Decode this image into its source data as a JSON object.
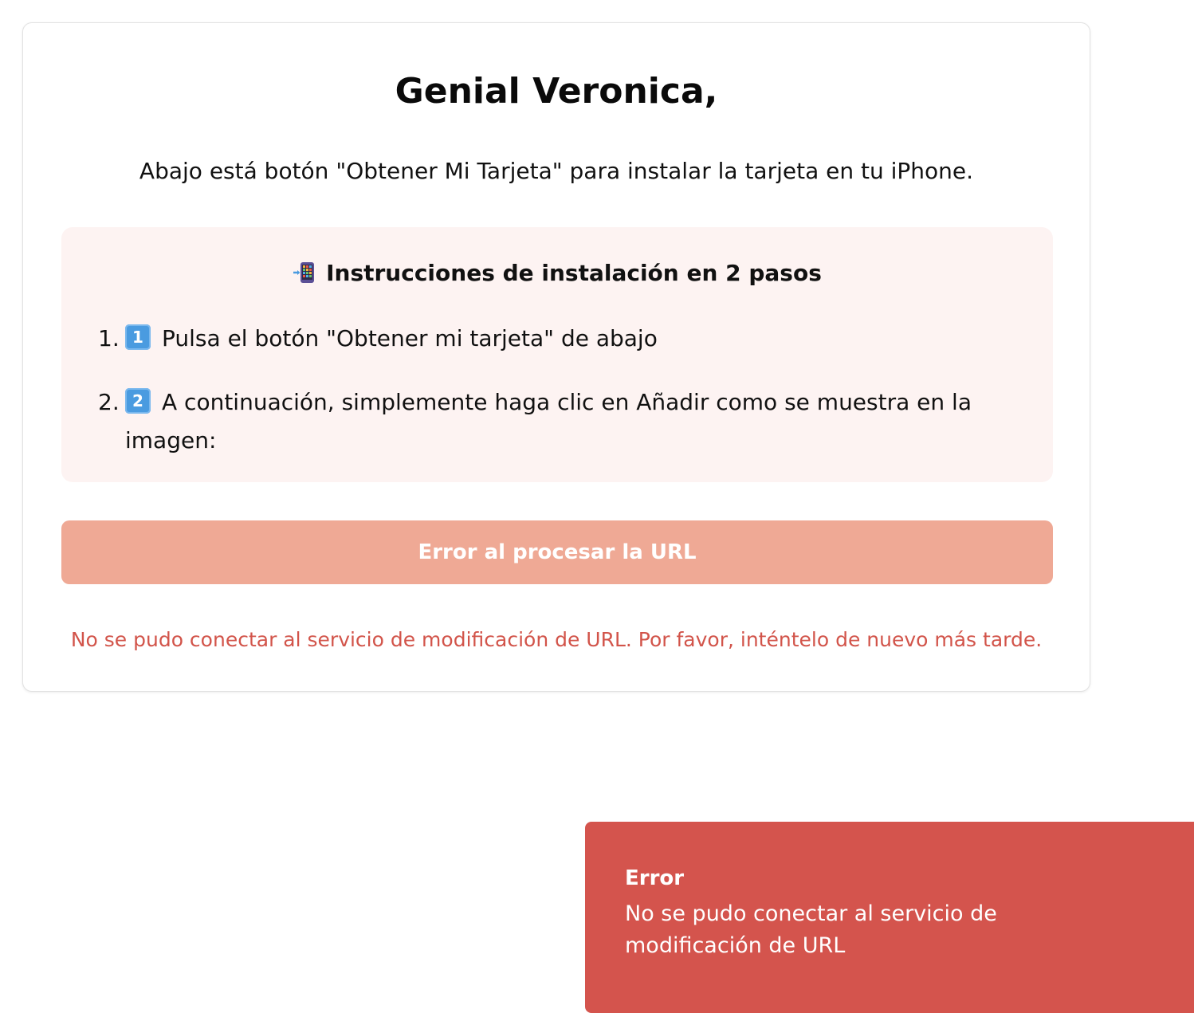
{
  "card": {
    "title": "Genial Veronica,",
    "subtitle": "Abajo está botón \"Obtener Mi Tarjeta\" para instalar la tarjeta en tu iPhone."
  },
  "instructions": {
    "icon": "phone-with-arrow-icon",
    "heading": "Instrucciones de instalación en 2 pasos",
    "steps": [
      {
        "number": "1.",
        "keycap": "1",
        "text": "Pulsa el botón \"Obtener mi tarjeta\" de abajo"
      },
      {
        "number": "2.",
        "keycap": "2",
        "text": "A continuación, simplemente haga clic en Añadir como se muestra en la imagen:"
      }
    ]
  },
  "action": {
    "button_label": "Error al procesar la URL",
    "error_message": "No se pudo conectar al servicio de modificación de URL. Por favor, inténtelo de nuevo más tarde."
  },
  "toast": {
    "title": "Error",
    "message": "No se pudo conectar al servicio de modificación de URL"
  },
  "colors": {
    "instructions_bg": "#fdf3f2",
    "button_bg": "#efa995",
    "error_text": "#d2544a",
    "toast_bg": "#d4544d",
    "keycap_bg": "#4a9be0"
  }
}
